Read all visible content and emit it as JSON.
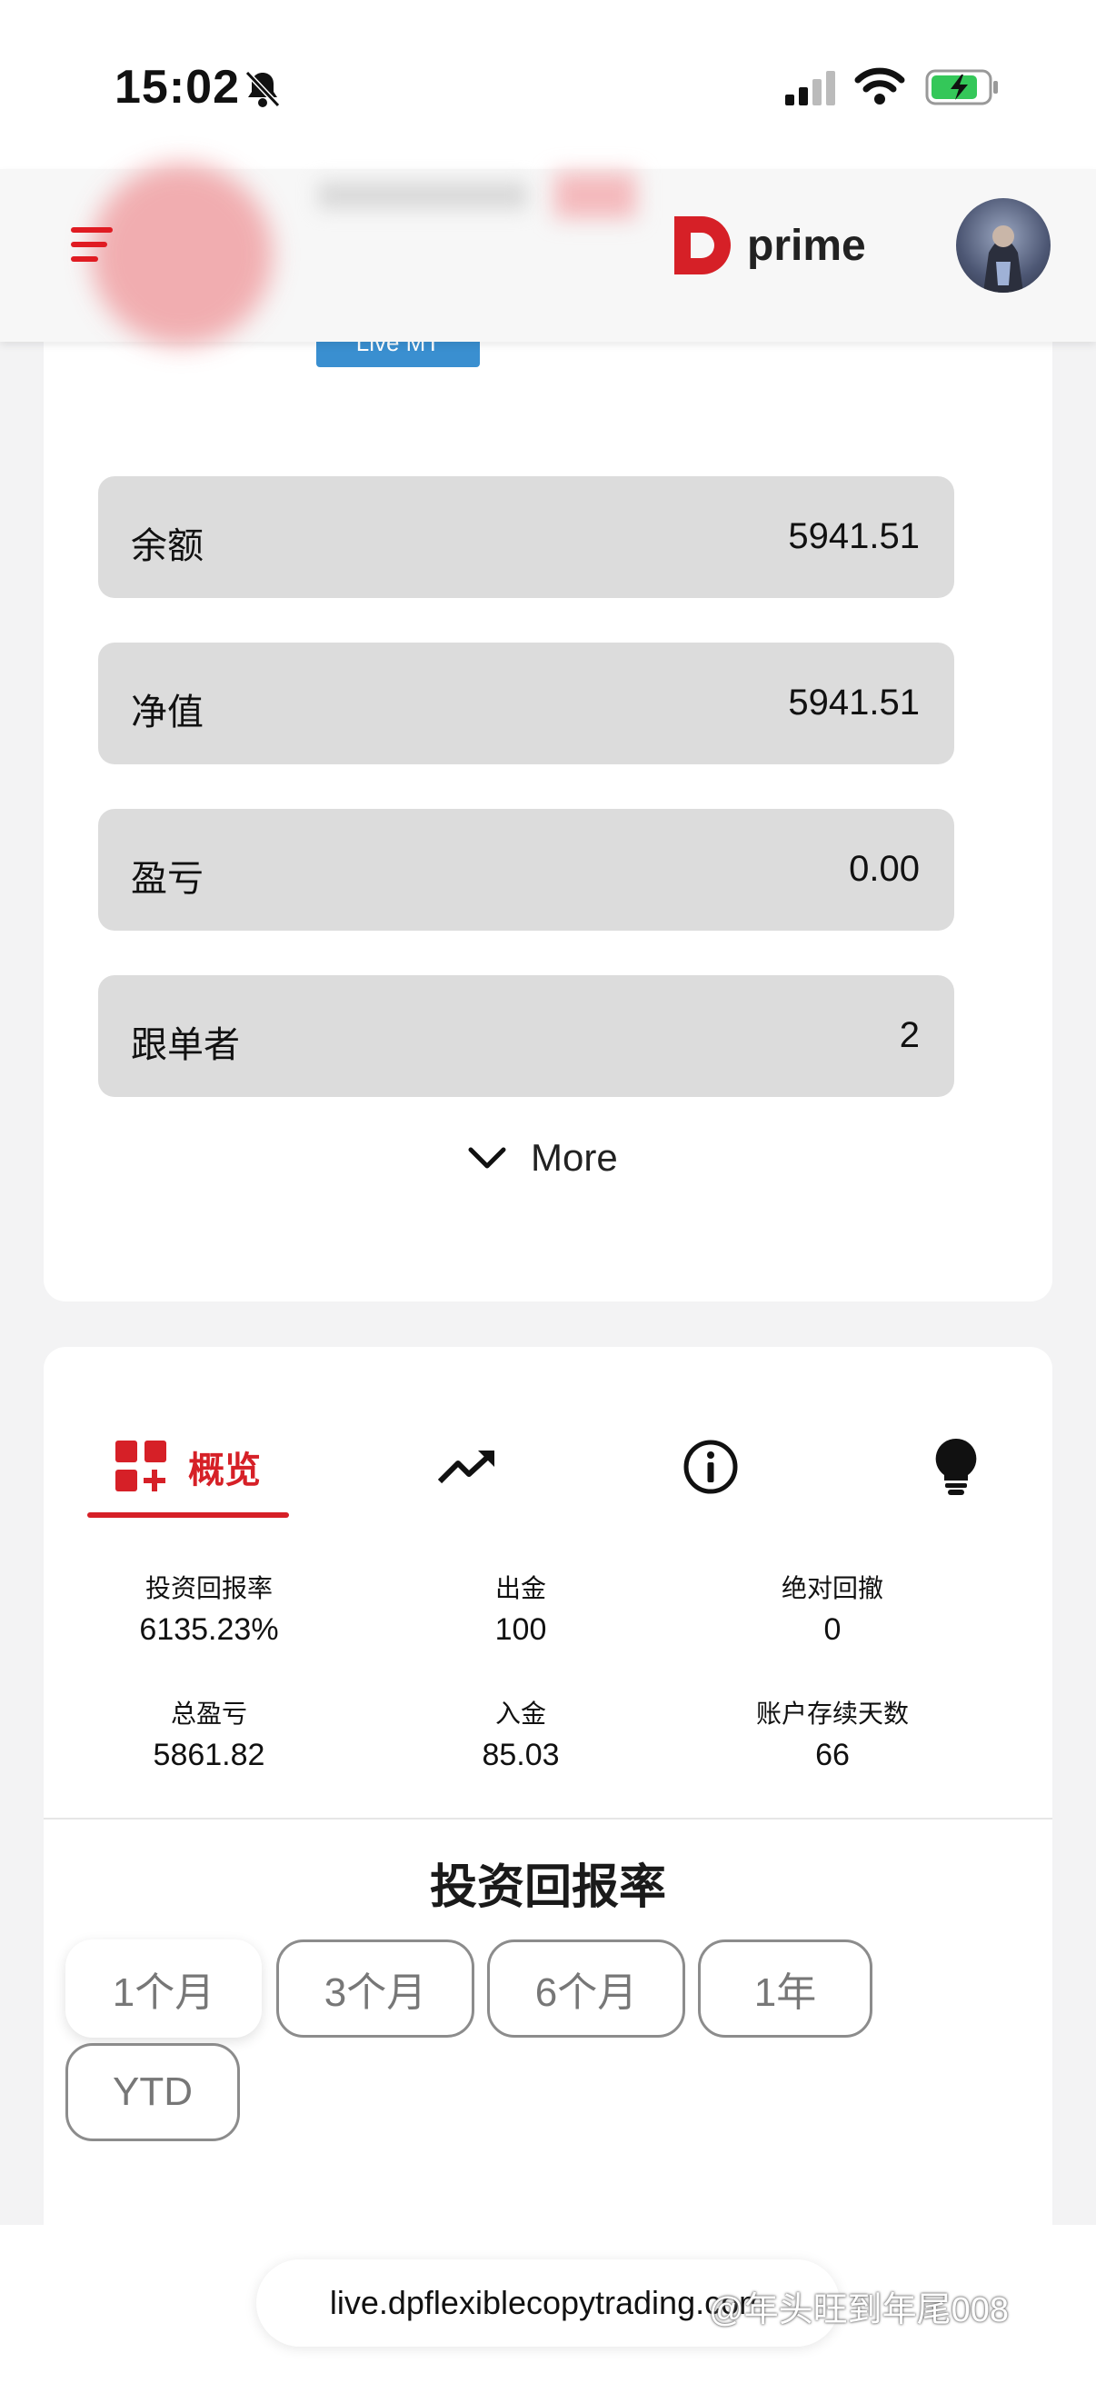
{
  "status_bar": {
    "time": "15:02"
  },
  "header": {
    "logo_text": "prime"
  },
  "profile": {
    "tag": "Live MT"
  },
  "stats": [
    {
      "label": "余额",
      "value": "5941.51"
    },
    {
      "label": "净值",
      "value": "5941.51"
    },
    {
      "label": "盈亏",
      "value": "0.00"
    },
    {
      "label": "跟单者",
      "value": "2"
    }
  ],
  "more_label": "More",
  "tabs": {
    "overview_label": "概览",
    "icons": [
      "overview-grid-icon",
      "trend-up-icon",
      "info-icon",
      "lightbulb-icon"
    ]
  },
  "metrics": [
    {
      "label": "投资回报率",
      "value": "6135.23%"
    },
    {
      "label": "出金",
      "value": "100"
    },
    {
      "label": "绝对回撤",
      "value": "0"
    },
    {
      "label": "总盈亏",
      "value": "5861.82"
    },
    {
      "label": "入金",
      "value": "85.03"
    },
    {
      "label": "账户存续天数",
      "value": "66"
    }
  ],
  "chart_section": {
    "title": "投资回报率",
    "periods": [
      "1个月",
      "3个月",
      "6个月",
      "1年",
      "YTD"
    ],
    "selected_period": "1个月"
  },
  "browser": {
    "url": "live.dpflexiblecopytrading.com"
  },
  "watermark": "@年头旺到年尾008",
  "colors": {
    "brand_red": "#d62027",
    "row_gray": "#dcdcdc",
    "tag_blue": "#3a8fd0"
  }
}
